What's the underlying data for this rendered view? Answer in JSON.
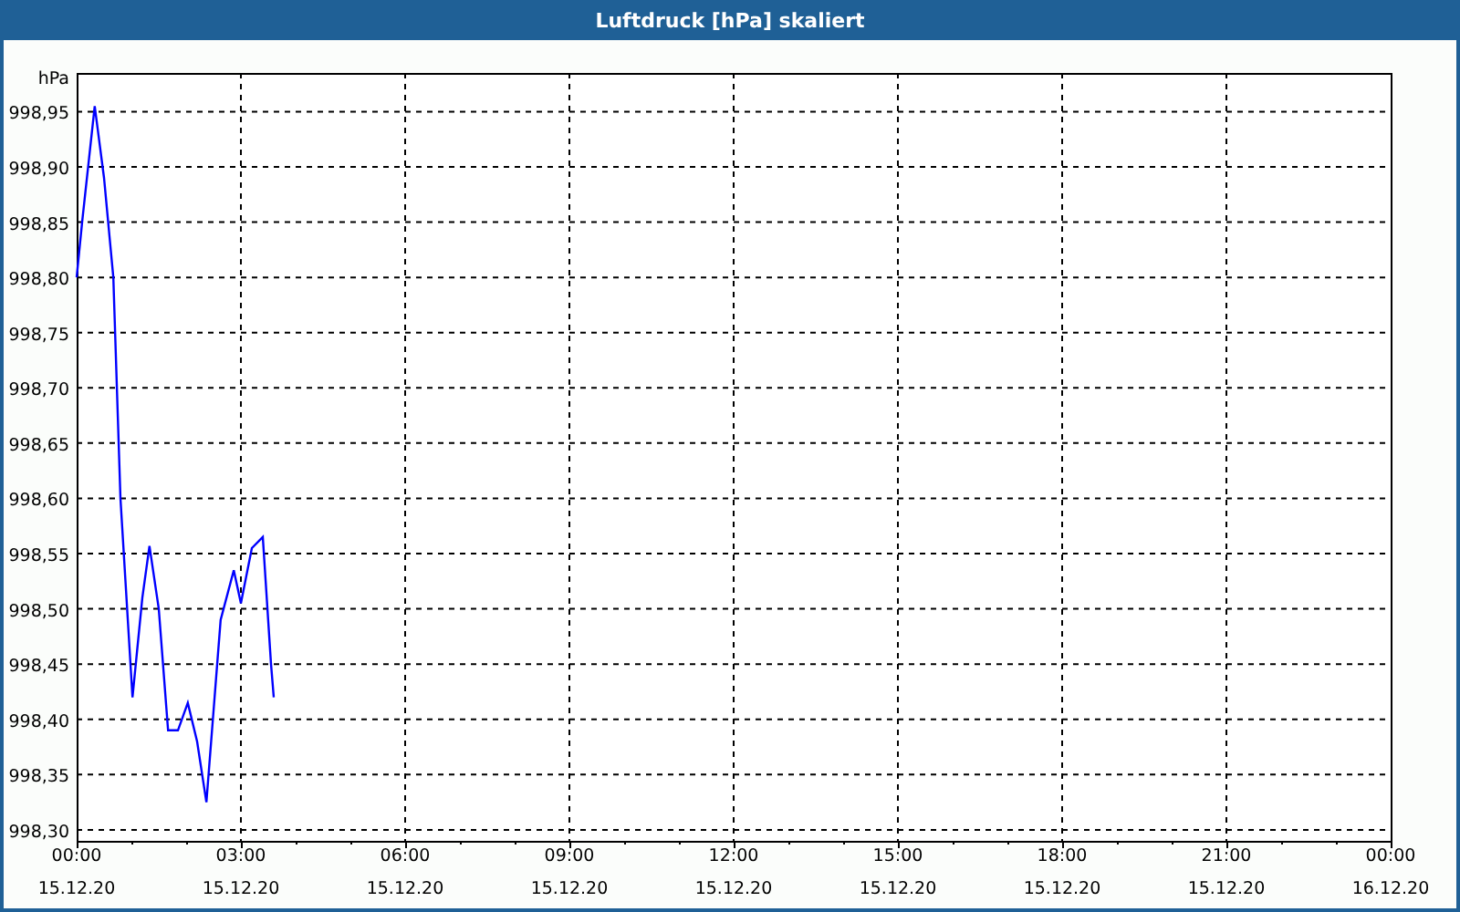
{
  "window": {
    "title": "Luftdruck [hPa] skaliert"
  },
  "chart": {
    "tick_dates": [
      "15.12.20",
      "15.12.20",
      "15.12.20",
      "15.12.20",
      "15.12.20",
      "15.12.20",
      "15.12.20",
      "15.12.20",
      "16.12.20"
    ],
    "chart_data": {
      "type": "line",
      "ylabel": "hPa",
      "x": [
        0,
        0.1,
        0.33,
        0.5,
        0.67,
        0.8,
        1.02,
        1.2,
        1.33,
        1.5,
        1.67,
        1.85,
        2.03,
        2.2,
        2.37,
        2.63,
        2.87,
        3.0,
        3.2,
        3.4,
        3.55,
        3.6
      ],
      "series": [
        {
          "color": "#0000ff",
          "values": [
            998.8,
            998.85,
            998.955,
            998.89,
            998.8,
            998.6,
            998.42,
            998.51,
            998.557,
            998.5,
            998.39,
            998.39,
            998.415,
            998.38,
            998.325,
            998.49,
            998.535,
            998.505,
            998.555,
            998.565,
            998.45,
            998.42
          ]
        }
      ],
      "xlim": [
        0,
        24
      ],
      "ylim": [
        998.29,
        998.985
      ],
      "xticks": [
        {
          "value": 0,
          "label": "00:00"
        },
        {
          "value": 3,
          "label": "03:00"
        },
        {
          "value": 6,
          "label": "06:00"
        },
        {
          "value": 9,
          "label": "09:00"
        },
        {
          "value": 12,
          "label": "12:00"
        },
        {
          "value": 15,
          "label": "15:00"
        },
        {
          "value": 18,
          "label": "18:00"
        },
        {
          "value": 21,
          "label": "21:00"
        },
        {
          "value": 24,
          "label": "00:00"
        }
      ],
      "grid": true,
      "yticks": [
        {
          "value": 998.3,
          "label": "998,30"
        },
        {
          "value": 998.35,
          "label": "998,35"
        },
        {
          "value": 998.4,
          "label": "998,40"
        },
        {
          "value": 998.45,
          "label": "998,45"
        },
        {
          "value": 998.5,
          "label": "998,50"
        },
        {
          "value": 998.55,
          "label": "998,55"
        },
        {
          "value": 998.6,
          "label": "998,60"
        },
        {
          "value": 998.65,
          "label": "998,65"
        },
        {
          "value": 998.7,
          "label": "998,70"
        },
        {
          "value": 998.75,
          "label": "998,75"
        },
        {
          "value": 998.8,
          "label": "998,80"
        },
        {
          "value": 998.85,
          "label": "998,85"
        },
        {
          "value": 998.9,
          "label": "998,90"
        },
        {
          "value": 998.95,
          "label": "998,95"
        }
      ]
    }
  }
}
